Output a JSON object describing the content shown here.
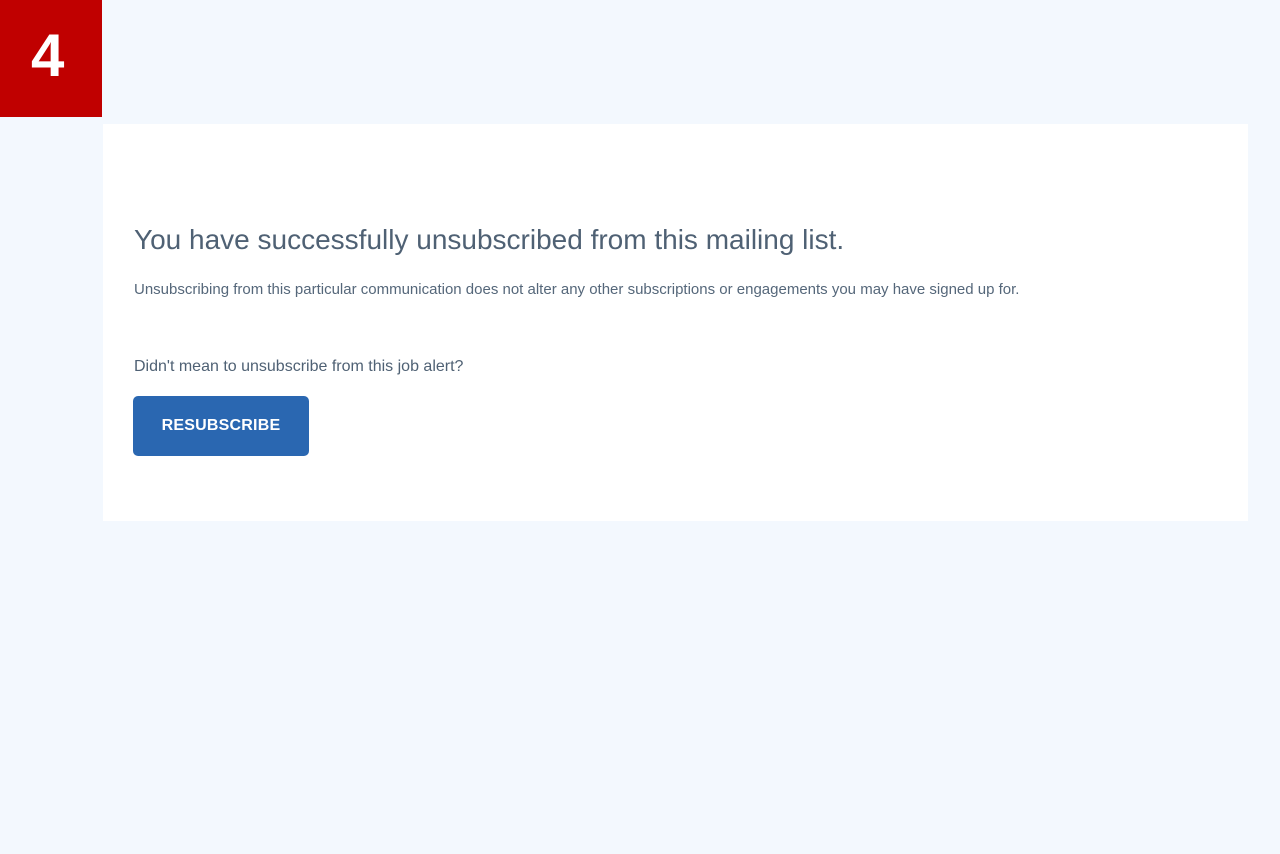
{
  "step_badge": {
    "number": "4",
    "color": "#c00000"
  },
  "card": {
    "headline": "You have successfully unsubscribed from this mailing list.",
    "subtext": "Unsubscribing from this particular communication does not alter any other subscriptions or engagements you may have signed up for.",
    "question": "Didn't mean to unsubscribe from this job alert?",
    "resubscribe_label": "RESUBSCRIBE"
  },
  "colors": {
    "page_background": "#f3f8fe",
    "card_background": "#ffffff",
    "button": "#2a67b1",
    "text": "#4f6174"
  }
}
